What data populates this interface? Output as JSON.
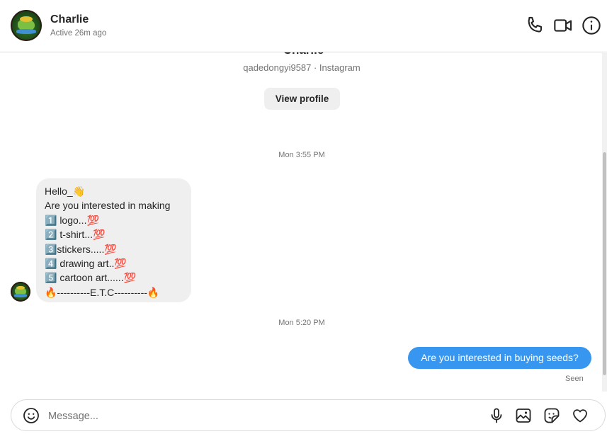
{
  "header": {
    "name": "Charlie",
    "status": "Active 26m ago"
  },
  "profile": {
    "name": "Charlie",
    "handle": "qadedongyi9587 · Instagram",
    "view_profile_label": "View profile"
  },
  "messages": {
    "timestamp_1": "Mon 3:55 PM",
    "incoming_lines": [
      "Hello_👋",
      "Are you interested in making",
      "1️⃣ logo...💯",
      "2️⃣ t-shirt...💯",
      "3️⃣stickers.....💯",
      "4️⃣ drawing art..💯",
      "5️⃣ cartoon art......💯",
      "🔥----------E.T.C----------🔥"
    ],
    "timestamp_2": "Mon 5:20 PM",
    "outgoing": "Are you interested in buying seeds?",
    "seen": "Seen"
  },
  "composer": {
    "placeholder": "Message..."
  },
  "icons": {
    "header": [
      "phone-icon",
      "video-icon",
      "info-icon"
    ],
    "composer": [
      "emoji-icon",
      "microphone-icon",
      "image-icon",
      "sticker-icon",
      "heart-icon"
    ]
  },
  "colors": {
    "outgoing_bubble": "#3797f0",
    "incoming_bubble": "#efefef",
    "secondary_text": "#737373"
  }
}
